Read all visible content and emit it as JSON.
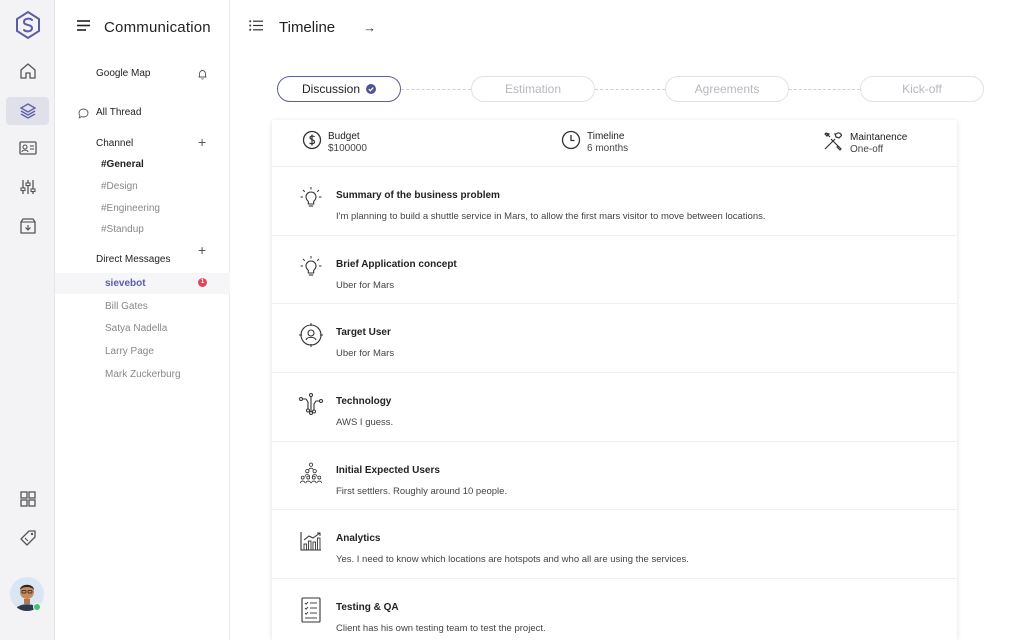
{
  "panel": {
    "title": "Communication",
    "google_map": "Google Map",
    "all_thread": "All Thread",
    "channel_heading": "Channel",
    "channels": [
      "#General",
      "#Design",
      "#Engineering",
      "#Standup"
    ],
    "dm_heading": "Direct Messages",
    "direct_messages": [
      "sievebot",
      "Bill Gates",
      "Satya Nadella",
      "Larry Page",
      "Mark Zuckerburg"
    ],
    "unread_badge": "1",
    "plus_glyph": "+"
  },
  "header": {
    "title": "Timeline",
    "arrow": "→"
  },
  "steps": [
    "Discussion",
    "Estimation",
    "Agreements",
    "Kick-off"
  ],
  "meta": {
    "budget_label": "Budget",
    "budget_value": "$100000",
    "timeline_label": "Timeline",
    "timeline_value": "6 months",
    "maintenance_label": "Maintanence",
    "maintenance_value": "One-off"
  },
  "items": [
    {
      "title": "Summary of the business problem",
      "body": "I'm planning to build a shuttle service in Mars, to allow the first mars visitor to move between locations.",
      "icon": "lightbulb-icon"
    },
    {
      "title": "Brief Application concept",
      "body": "Uber for Mars",
      "icon": "lightbulb-icon"
    },
    {
      "title": "Target User",
      "body": "Uber for Mars",
      "icon": "target-user-icon"
    },
    {
      "title": "Technology",
      "body": "AWS I guess.",
      "icon": "circuit-icon"
    },
    {
      "title": "Initial Expected Users",
      "body": "First settlers. Roughly around 10 people.",
      "icon": "users-group-icon"
    },
    {
      "title": "Analytics",
      "body": "Yes. I need to know which locations are hotspots and who all are using the services.",
      "icon": "analytics-icon"
    },
    {
      "title": "Testing & QA",
      "body": "Client has his own testing team to test the project.",
      "icon": "checklist-icon"
    }
  ],
  "colors": {
    "accent": "#5b5ea6",
    "badge": "#e2445c",
    "online": "#3cc46a"
  }
}
